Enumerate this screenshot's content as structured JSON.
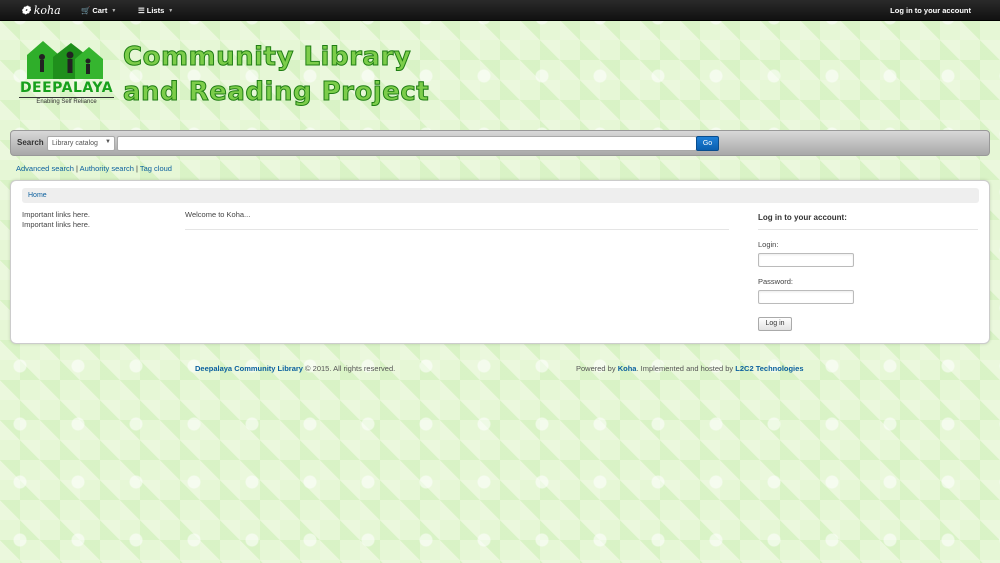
{
  "navbar": {
    "brand": "koha",
    "cart_label": "Cart",
    "lists_label": "Lists",
    "login_link": "Log in to your account"
  },
  "banner": {
    "logo_name": "DEEPALAYA",
    "logo_tagline": "Enabling Self Reliance",
    "title_line1": "Community Library",
    "title_line2": "and Reading Project"
  },
  "search": {
    "label": "Search",
    "selected_option": "Library catalog",
    "query": "",
    "go_label": "Go"
  },
  "more_searches": {
    "advanced": "Advanced search",
    "authority": "Authority search",
    "tag_cloud": "Tag cloud",
    "separator": "|"
  },
  "breadcrumb": {
    "home": "Home"
  },
  "content": {
    "links": [
      "Important links here.",
      "Important links here."
    ],
    "welcome": "Welcome to Koha..."
  },
  "login": {
    "title": "Log in to your account:",
    "login_label": "Login:",
    "password_label": "Password:",
    "button_label": "Log in"
  },
  "footer": {
    "org_link": "Deepalaya Community Library",
    "copyright": "© 2015. All rights reserved.",
    "powered_by": "Powered by",
    "koha_link": "Koha",
    "implemented": "Implemented and hosted by",
    "vendor_link": "L2C2 Technologies"
  }
}
